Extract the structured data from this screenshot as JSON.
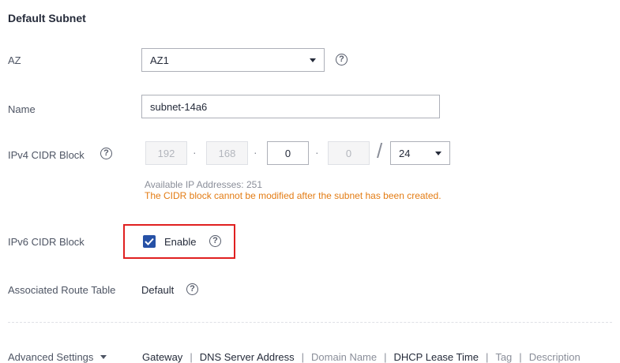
{
  "section_title": "Default Subnet",
  "az": {
    "label": "AZ",
    "value": "AZ1",
    "help": "?"
  },
  "name": {
    "label": "Name",
    "value": "subnet-14a6"
  },
  "ipv4": {
    "label": "IPv4 CIDR Block",
    "help": "?",
    "octets": [
      "192",
      "168",
      "0",
      "0"
    ],
    "dot": "·",
    "slash": "/",
    "mask": "24",
    "available_ips": "Available IP Addresses: 251",
    "warning": "The CIDR block cannot be modified after the subnet has been created."
  },
  "ipv6": {
    "label": "IPv6 CIDR Block",
    "checkbox_label": "Enable",
    "checked": true,
    "help": "?"
  },
  "route_table": {
    "label": "Associated Route Table",
    "value": "Default",
    "help": "?"
  },
  "advanced": {
    "label": "Advanced Settings",
    "separator": "|",
    "items": [
      {
        "label": "Gateway",
        "state": "on"
      },
      {
        "label": "DNS Server Address",
        "state": "on"
      },
      {
        "label": "Domain Name",
        "state": "off"
      },
      {
        "label": "DHCP Lease Time",
        "state": "on"
      },
      {
        "label": "Tag",
        "state": "off"
      },
      {
        "label": "Description",
        "state": "off"
      }
    ]
  },
  "colors": {
    "accent": "#2651a6",
    "warning": "#e37c14",
    "highlight_border": "#e02020"
  }
}
